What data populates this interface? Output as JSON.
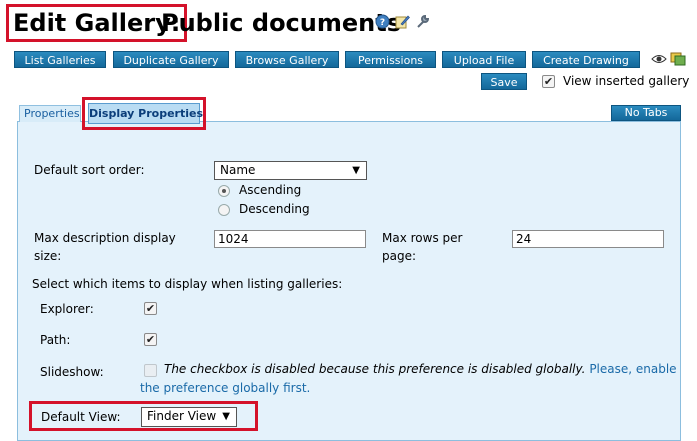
{
  "title": {
    "edit_label": "Edit Gallery:",
    "gallery_name": "Public documents",
    "icons": [
      "help-icon",
      "edit-icon",
      "wrench-icon"
    ]
  },
  "toolbar": {
    "buttons": [
      {
        "label": "List Galleries"
      },
      {
        "label": "Duplicate Gallery"
      },
      {
        "label": "Browse Gallery"
      },
      {
        "label": "Permissions"
      },
      {
        "label": "Upload File"
      },
      {
        "label": "Create Drawing"
      }
    ],
    "save_label": "Save",
    "view_inserted_label": "View inserted gallery",
    "view_inserted_checked": true,
    "icons": [
      "eye-icon",
      "gallery-icon"
    ]
  },
  "tabs": {
    "items": [
      "Properties",
      "Display Properties"
    ],
    "active": "Display Properties",
    "no_tabs_label": "No Tabs"
  },
  "form": {
    "sort_order_label": "Default sort order:",
    "sort_order_value": "Name",
    "radio_ascending": "Ascending",
    "radio_descending": "Descending",
    "selected_order": "Ascending",
    "max_desc_label_1": "Max description display",
    "max_desc_label_2": "size:",
    "max_desc_value": "1024",
    "max_rows_label_1": "Max rows per",
    "max_rows_label_2": "page:",
    "max_rows_value": "24",
    "select_items_label": "Select which items to display when listing galleries:",
    "explorer_label": "Explorer:",
    "explorer_checked": true,
    "path_label": "Path:",
    "path_checked": true,
    "slideshow_label": "Slideshow:",
    "slideshow_disabled_note": "The checkbox is disabled because this preference is disabled globally.",
    "enable_link_part1": "Please, enable",
    "enable_link_part2": "the preference globally first.",
    "default_view_label": "Default View:",
    "default_view_value": "Finder View"
  },
  "colors": {
    "button_blue": "#1b78ad",
    "panel_bg": "#e4f2fb",
    "highlight_red": "#d4122a",
    "link_blue": "#1a6aa8"
  }
}
